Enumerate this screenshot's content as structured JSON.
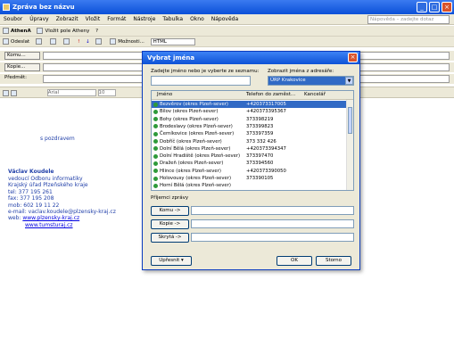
{
  "window": {
    "title": "Zpráva bez názvu",
    "min": "_",
    "max": "□",
    "close": "×"
  },
  "menu": [
    "Soubor",
    "Úpravy",
    "Zobrazit",
    "Vložit",
    "Formát",
    "Nástroje",
    "Tabulka",
    "Okno",
    "Nápověda"
  ],
  "help_placeholder": "Nápověda – zadejte dotaz",
  "toolbar1": [
    "AthenA",
    "Vložit pole Atheny",
    "?"
  ],
  "toolbar2": {
    "send": "Odeslat",
    "options": "Možnosti...",
    "format": "HTML"
  },
  "address": {
    "to": "Komu...",
    "cc": "Kopie...",
    "subject": "Předmět:"
  },
  "format_bar": {
    "style": "Arial",
    "size": "10"
  },
  "body": {
    "greeting": "s pozdravem",
    "name": "Václav Koudele",
    "lines": [
      "vedoucí Odboru informatiky",
      "Krajský úřad Plzeňského kraje",
      "tel: 377 195 261",
      "fax: 377 195 208",
      "mob: 602 19 11 22",
      "e-mail: vaclav.koudele@plzensky-kraj.cz"
    ],
    "web_label": "web:",
    "web1": "www.plzensky-kraj.cz",
    "web2": "www.tumsturaj.cz"
  },
  "dialog": {
    "title": "Vybrat jména",
    "search_label": "Zadejte jméno nebo je vyberte ze seznamu:",
    "addrbook_label": "Zobrazit jména z adresáře:",
    "addrbook_value": "ÚRP Krakovice",
    "columns": [
      "Jméno",
      "Telefon do zaměst...",
      "Kancelář"
    ],
    "rows": [
      {
        "name": "Bezvěrov (okres Plzeň-sever)",
        "phone": "+420373317005"
      },
      {
        "name": "Bílov (okres Plzeň-sever)",
        "phone": "+420373395367"
      },
      {
        "name": "Bohy (okres Plzeň-sever)",
        "phone": "373398219"
      },
      {
        "name": "Brodeslavy (okres Plzeň-sever)",
        "phone": "373399823"
      },
      {
        "name": "Černíkovice (okres Plzeň-sever)",
        "phone": "373397359"
      },
      {
        "name": "Dobříč (okres Plzeň-sever)",
        "phone": "373 332 426"
      },
      {
        "name": "Dolní Bělá (okres Plzeň-sever)",
        "phone": "+420373394347"
      },
      {
        "name": "Dolní Hradiště (okres Plzeň-sever)",
        "phone": "373397470"
      },
      {
        "name": "Dražeň (okres Plzeň-sever)",
        "phone": "373394560"
      },
      {
        "name": "Hlince (okres Plzeň-sever)",
        "phone": "+420373390050"
      },
      {
        "name": "Holovousy (okres Plzeň-sever)",
        "phone": "373390105"
      },
      {
        "name": "Horní Bělá (okres Plzeň-sever)",
        "phone": ""
      }
    ],
    "recipients_label": "Příjemci zprávy",
    "to_btn": "Komu ->",
    "cc_btn": "Kopie ->",
    "bcc_btn": "Skrytá ->",
    "advanced": "Upřesnit",
    "ok": "OK",
    "cancel": "Storno"
  }
}
